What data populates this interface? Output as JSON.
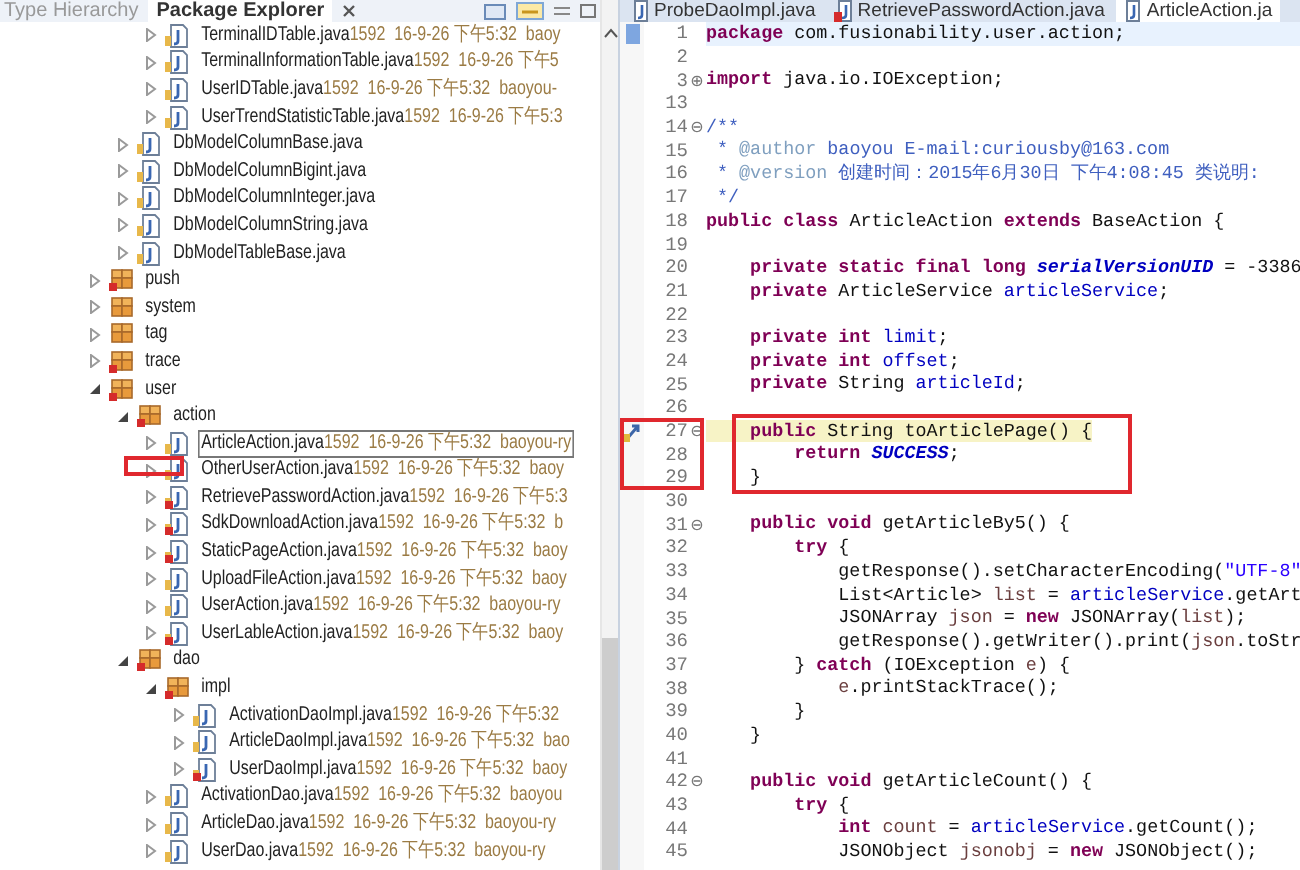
{
  "explorer": {
    "tabs": [
      {
        "label": "Type Hierarchy",
        "selected": false
      },
      {
        "label": "Package Explorer",
        "selected": true
      }
    ],
    "tree": [
      {
        "children": [
          {
            "children": [
              {
                "label": "TerminalIDTable.java",
                "info": "1592  16-9-26 下午5:32  baoy",
                "kind": "file",
                "error": false,
                "expanded": false,
                "selected": false
              },
              {
                "label": "TerminalInformationTable.java",
                "info": "1592  16-9-26 下午5",
                "kind": "file",
                "error": false,
                "expanded": false,
                "selected": false
              },
              {
                "label": "UserIDTable.java",
                "info": "1592  16-9-26 下午5:32  baoyou-",
                "kind": "file",
                "error": false,
                "expanded": false,
                "selected": false
              },
              {
                "label": "UserTrendStatisticTable.java",
                "info": "1592  16-9-26 下午5:3",
                "kind": "file",
                "error": false,
                "expanded": false,
                "selected": false
              }
            ]
          },
          {
            "label": "DbModelColumnBase.java",
            "kind": "file",
            "error": false,
            "expanded": false,
            "selected": false
          },
          {
            "label": "DbModelColumnBigint.java",
            "kind": "file",
            "error": false,
            "expanded": false,
            "selected": false
          },
          {
            "label": "DbModelColumnInteger.java",
            "kind": "file",
            "error": false,
            "expanded": false,
            "selected": false
          },
          {
            "label": "DbModelColumnString.java",
            "kind": "file",
            "error": false,
            "expanded": false,
            "selected": false
          },
          {
            "label": "DbModelTableBase.java",
            "kind": "file",
            "error": false,
            "expanded": false,
            "selected": false
          }
        ]
      },
      {
        "label": "push",
        "kind": "package",
        "error": true,
        "expanded": false,
        "selected": false
      },
      {
        "label": "system",
        "kind": "package",
        "error": false,
        "expanded": false,
        "selected": false
      },
      {
        "label": "tag",
        "kind": "package",
        "error": false,
        "expanded": false,
        "selected": false
      },
      {
        "label": "trace",
        "kind": "package",
        "error": true,
        "expanded": false,
        "selected": false
      },
      {
        "label": "user",
        "kind": "package",
        "error": true,
        "expanded": true,
        "selected": false,
        "children": [
          {
            "label": "action",
            "kind": "package",
            "error": true,
            "expanded": true,
            "selected": false,
            "children": [
              {
                "label": "ArticleAction.java",
                "info": "1592  16-9-26 下午5:32  baoyou-ry",
                "kind": "file",
                "error": false,
                "expanded": false,
                "selected": true
              },
              {
                "label": "OtherUserAction.java",
                "info": "1592  16-9-26 下午5:32  baoy",
                "kind": "file",
                "error": false,
                "expanded": false,
                "selected": false
              },
              {
                "label": "RetrievePasswordAction.java",
                "info": "1592  16-9-26 下午5:3",
                "kind": "file",
                "error": true,
                "expanded": false,
                "selected": false
              },
              {
                "label": "SdkDownloadAction.java",
                "info": "1592  16-9-26 下午5:32  b",
                "kind": "file",
                "error": true,
                "expanded": false,
                "selected": false
              },
              {
                "label": "StaticPageAction.java",
                "info": "1592  16-9-26 下午5:32  baoy",
                "kind": "file",
                "error": true,
                "expanded": false,
                "selected": false
              },
              {
                "label": "UploadFileAction.java",
                "info": "1592  16-9-26 下午5:32  baoy",
                "kind": "file",
                "error": false,
                "expanded": false,
                "selected": false
              },
              {
                "label": "UserAction.java",
                "info": "1592  16-9-26 下午5:32  baoyou-ry",
                "kind": "file",
                "error": false,
                "expanded": false,
                "selected": false
              },
              {
                "label": "UserLableAction.java",
                "info": "1592  16-9-26 下午5:32  baoy",
                "kind": "file",
                "error": true,
                "expanded": false,
                "selected": false
              }
            ]
          },
          {
            "label": "dao",
            "kind": "package",
            "error": true,
            "expanded": true,
            "selected": false,
            "children": [
              {
                "label": "impl",
                "kind": "package",
                "error": true,
                "expanded": true,
                "selected": false,
                "children": [
                  {
                    "label": "ActivationDaoImpl.java",
                    "info": "1592  16-9-26 下午5:32",
                    "kind": "file",
                    "error": false,
                    "expanded": false,
                    "selected": false
                  },
                  {
                    "label": "ArticleDaoImpl.java",
                    "info": "1592  16-9-26 下午5:32  bao",
                    "kind": "file",
                    "error": false,
                    "expanded": false,
                    "selected": false
                  },
                  {
                    "label": "UserDaoImpl.java",
                    "info": "1592  16-9-26 下午5:32  baoy",
                    "kind": "file",
                    "error": true,
                    "expanded": false,
                    "selected": false
                  }
                ]
              },
              {
                "label": "ActivationDao.java",
                "info": "1592  16-9-26 下午5:32  baoyou",
                "kind": "file",
                "error": false,
                "expanded": false,
                "selected": false
              },
              {
                "label": "ArticleDao.java",
                "info": "1592  16-9-26 下午5:32  baoyou-ry",
                "kind": "file",
                "error": false,
                "expanded": false,
                "selected": false
              },
              {
                "label": "UserDao.java",
                "info": "1592  16-9-26 下午5:32  baoyou-ry",
                "kind": "file",
                "error": false,
                "expanded": false,
                "selected": false
              }
            ]
          }
        ]
      }
    ]
  },
  "editor": {
    "tabs": [
      {
        "label": "ProbeDaoImpl.java",
        "selected": false,
        "error": false
      },
      {
        "label": "RetrievePasswordAction.java",
        "selected": false,
        "error": true
      },
      {
        "label": "ArticleAction.ja",
        "selected": true,
        "error": false
      }
    ],
    "code": [
      {
        "number": "1",
        "kind": "bookmark",
        "current": true,
        "occurrence": false,
        "tokens": [
          {
            "kind": "kw",
            "text": "package "
          },
          {
            "kind": "plain",
            "text": "com.fusionability.user.action;"
          }
        ]
      },
      {
        "number": "2",
        "kind": "plain",
        "current": false,
        "occurrence": false
      },
      {
        "number": "3",
        "kind": "plain",
        "current": false,
        "occurrence": false,
        "fold": "⊕",
        "tokens": [
          {
            "kind": "kw",
            "text": "import "
          },
          {
            "kind": "plain",
            "text": "java.io.IOException;"
          }
        ]
      },
      {
        "number": "13",
        "kind": "plain",
        "current": false,
        "occurrence": false
      },
      {
        "number": "14",
        "kind": "plain",
        "current": false,
        "occurrence": false,
        "fold": "⊖",
        "tokens": [
          {
            "kind": "comment",
            "text": "/**"
          }
        ]
      },
      {
        "number": "15",
        "kind": "plain",
        "current": false,
        "occurrence": false,
        "tokens": [
          {
            "kind": "comment",
            "text": " * "
          },
          {
            "kind": "tag",
            "text": "@author"
          },
          {
            "kind": "comment",
            "text": " baoyou E-mail:curiousby@163.com"
          }
        ]
      },
      {
        "number": "16",
        "kind": "plain",
        "current": false,
        "occurrence": false,
        "tokens": [
          {
            "kind": "comment",
            "text": " * "
          },
          {
            "kind": "tag",
            "text": "@version"
          },
          {
            "kind": "comment",
            "text": " 创建时间：2015年6月30日 下午4:08:45 类说明:"
          }
        ]
      },
      {
        "number": "17",
        "kind": "plain",
        "current": false,
        "occurrence": false,
        "tokens": [
          {
            "kind": "comment",
            "text": " */"
          }
        ]
      },
      {
        "number": "18",
        "kind": "plain",
        "current": false,
        "occurrence": false,
        "tokens": [
          {
            "kind": "kw",
            "text": "public class "
          },
          {
            "kind": "plain",
            "text": "ArticleAction "
          },
          {
            "kind": "kw",
            "text": "extends "
          },
          {
            "kind": "plain",
            "text": "BaseAction {"
          }
        ]
      },
      {
        "number": "19",
        "kind": "plain",
        "current": false,
        "occurrence": false
      },
      {
        "number": "20",
        "kind": "plain",
        "current": false,
        "occurrence": false,
        "tokens": [
          {
            "kind": "kw",
            "text": "    private static final long "
          },
          {
            "kind": "static",
            "text": "serialVersionUID"
          },
          {
            "kind": "plain",
            "text": " = -3386"
          }
        ]
      },
      {
        "number": "21",
        "kind": "plain",
        "current": false,
        "occurrence": false,
        "tokens": [
          {
            "kind": "kw",
            "text": "    private "
          },
          {
            "kind": "plain",
            "text": "ArticleService "
          },
          {
            "kind": "field",
            "text": "articleService"
          },
          {
            "kind": "plain",
            "text": ";"
          }
        ]
      },
      {
        "number": "22",
        "kind": "plain",
        "current": false,
        "occurrence": false
      },
      {
        "number": "23",
        "kind": "plain",
        "current": false,
        "occurrence": false,
        "tokens": [
          {
            "kind": "kw",
            "text": "    private int "
          },
          {
            "kind": "field",
            "text": "limit"
          },
          {
            "kind": "plain",
            "text": ";"
          }
        ]
      },
      {
        "number": "24",
        "kind": "plain",
        "current": false,
        "occurrence": false,
        "tokens": [
          {
            "kind": "kw",
            "text": "    private int "
          },
          {
            "kind": "field",
            "text": "offset"
          },
          {
            "kind": "plain",
            "text": ";"
          }
        ]
      },
      {
        "number": "25",
        "kind": "plain",
        "current": false,
        "occurrence": false,
        "tokens": [
          {
            "kind": "kw",
            "text": "    private "
          },
          {
            "kind": "plain",
            "text": "String "
          },
          {
            "kind": "field",
            "text": "articleId"
          },
          {
            "kind": "plain",
            "text": ";"
          }
        ]
      },
      {
        "number": "26",
        "kind": "plain",
        "current": false,
        "occurrence": false
      },
      {
        "number": "27",
        "kind": "override",
        "current": false,
        "occurrence": true,
        "fold": "⊖",
        "tokens": [
          {
            "kind": "kw",
            "text": "    public "
          },
          {
            "kind": "plain",
            "text": "String toArticlePage() {"
          }
        ]
      },
      {
        "number": "28",
        "kind": "plain",
        "current": false,
        "occurrence": false,
        "tokens": [
          {
            "kind": "kw",
            "text": "        return "
          },
          {
            "kind": "static",
            "text": "SUCCESS"
          },
          {
            "kind": "plain",
            "text": ";"
          }
        ]
      },
      {
        "number": "29",
        "kind": "plain",
        "current": false,
        "occurrence": false,
        "tokens": [
          {
            "kind": "plain",
            "text": "    }"
          }
        ]
      },
      {
        "number": "30",
        "kind": "plain",
        "current": false,
        "occurrence": false
      },
      {
        "number": "31",
        "kind": "plain",
        "current": false,
        "occurrence": false,
        "fold": "⊖",
        "tokens": [
          {
            "kind": "kw",
            "text": "    public void "
          },
          {
            "kind": "plain",
            "text": "getArticleBy5() {"
          }
        ]
      },
      {
        "number": "32",
        "kind": "plain",
        "current": false,
        "occurrence": false,
        "tokens": [
          {
            "kind": "kw",
            "text": "        try "
          },
          {
            "kind": "plain",
            "text": "{"
          }
        ]
      },
      {
        "number": "33",
        "kind": "plain",
        "current": false,
        "occurrence": false,
        "tokens": [
          {
            "kind": "plain",
            "text": "            getResponse().setCharacterEncoding("
          },
          {
            "kind": "string",
            "text": "\"UTF-8\""
          }
        ]
      },
      {
        "number": "34",
        "kind": "plain",
        "current": false,
        "occurrence": false,
        "tokens": [
          {
            "kind": "plain",
            "text": "            List<Article> "
          },
          {
            "kind": "local",
            "text": "list"
          },
          {
            "kind": "plain",
            "text": " = "
          },
          {
            "kind": "field",
            "text": "articleService"
          },
          {
            "kind": "plain",
            "text": ".getArt"
          }
        ]
      },
      {
        "number": "35",
        "kind": "plain",
        "current": false,
        "occurrence": false,
        "tokens": [
          {
            "kind": "plain",
            "text": "            JSONArray "
          },
          {
            "kind": "local",
            "text": "json"
          },
          {
            "kind": "plain",
            "text": " = "
          },
          {
            "kind": "kw",
            "text": "new "
          },
          {
            "kind": "plain",
            "text": "JSONArray("
          },
          {
            "kind": "local",
            "text": "list"
          },
          {
            "kind": "plain",
            "text": ");"
          }
        ]
      },
      {
        "number": "36",
        "kind": "plain",
        "current": false,
        "occurrence": false,
        "tokens": [
          {
            "kind": "plain",
            "text": "            getResponse().getWriter().print("
          },
          {
            "kind": "local",
            "text": "json"
          },
          {
            "kind": "plain",
            "text": ".toStr"
          }
        ]
      },
      {
        "number": "37",
        "kind": "plain",
        "current": false,
        "occurrence": false,
        "tokens": [
          {
            "kind": "plain",
            "text": "        } "
          },
          {
            "kind": "kw",
            "text": "catch "
          },
          {
            "kind": "plain",
            "text": "(IOException "
          },
          {
            "kind": "local",
            "text": "e"
          },
          {
            "kind": "plain",
            "text": ") {"
          }
        ]
      },
      {
        "number": "38",
        "kind": "plain",
        "current": false,
        "occurrence": false,
        "tokens": [
          {
            "kind": "local",
            "text": "            e"
          },
          {
            "kind": "plain",
            "text": ".printStackTrace();"
          }
        ]
      },
      {
        "number": "39",
        "kind": "plain",
        "current": false,
        "occurrence": false,
        "tokens": [
          {
            "kind": "plain",
            "text": "        }"
          }
        ]
      },
      {
        "number": "40",
        "kind": "plain",
        "current": false,
        "occurrence": false,
        "tokens": [
          {
            "kind": "plain",
            "text": "    }"
          }
        ]
      },
      {
        "number": "41",
        "kind": "plain",
        "current": false,
        "occurrence": false
      },
      {
        "number": "42",
        "kind": "plain",
        "current": false,
        "occurrence": false,
        "fold": "⊖",
        "tokens": [
          {
            "kind": "kw",
            "text": "    public void "
          },
          {
            "kind": "plain",
            "text": "getArticleCount() {"
          }
        ]
      },
      {
        "number": "43",
        "kind": "plain",
        "current": false,
        "occurrence": false,
        "tokens": [
          {
            "kind": "kw",
            "text": "        try "
          },
          {
            "kind": "plain",
            "text": "{"
          }
        ]
      },
      {
        "number": "44",
        "kind": "plain",
        "current": false,
        "occurrence": false,
        "tokens": [
          {
            "kind": "kw",
            "text": "            int "
          },
          {
            "kind": "local",
            "text": "count"
          },
          {
            "kind": "plain",
            "text": " = "
          },
          {
            "kind": "field",
            "text": "articleService"
          },
          {
            "kind": "plain",
            "text": ".getCount();"
          }
        ]
      },
      {
        "number": "45",
        "kind": "plain",
        "current": false,
        "occurrence": false,
        "tokens": [
          {
            "kind": "plain",
            "text": "            JSONObject "
          },
          {
            "kind": "local",
            "text": "jsonobj"
          },
          {
            "kind": "plain",
            "text": " = "
          },
          {
            "kind": "kw",
            "text": "new "
          },
          {
            "kind": "plain",
            "text": "JSONObject();"
          }
        ]
      }
    ]
  }
}
